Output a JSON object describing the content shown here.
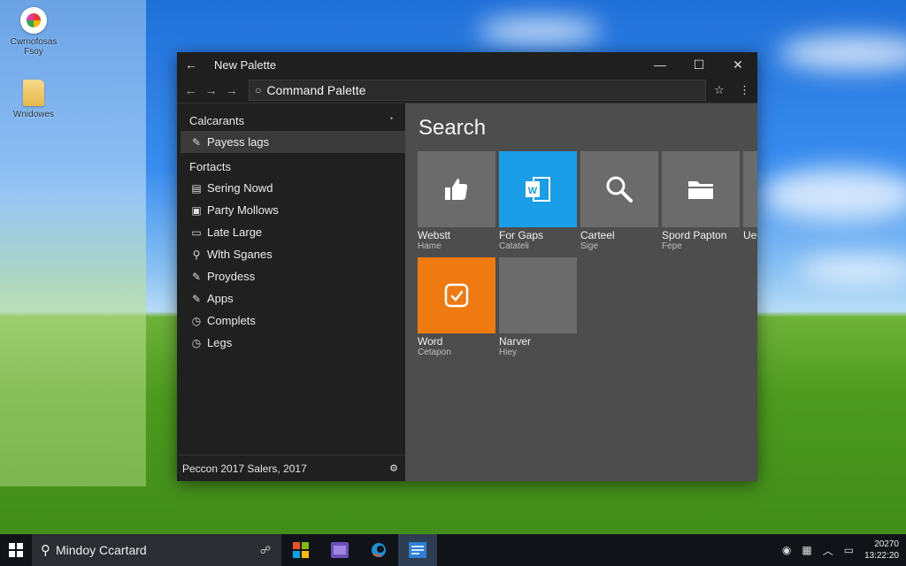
{
  "desktop": {
    "icons": [
      {
        "label_line1": "Cwrnofosas",
        "label_line2": "Fsoy",
        "icon": "photos-icon"
      },
      {
        "label_line1": "Wnidowes",
        "icon": "folder-icon"
      }
    ]
  },
  "window": {
    "title": "New Palette",
    "address": "Command Palette",
    "sidebar": {
      "section1": "Calcarants",
      "active_item": "Payess lags",
      "section2": "Fortacts",
      "items": [
        {
          "label": "Sering Nowd",
          "icon": "table-icon"
        },
        {
          "label": "Party Mollows",
          "icon": "image-icon"
        },
        {
          "label": "Late Large",
          "icon": "monitor-icon"
        },
        {
          "label": "Wlth Sganes",
          "icon": "wrench-icon"
        },
        {
          "label": "Proydess",
          "icon": "pencil-icon"
        },
        {
          "label": "Apps",
          "icon": "pencil-icon"
        },
        {
          "label": "Complets",
          "icon": "clock-icon"
        },
        {
          "label": "Legs",
          "icon": "clock-icon"
        }
      ],
      "footer": "Peccon 2017 Salers, 2017"
    },
    "main": {
      "heading": "Search",
      "tiles": [
        {
          "label": "Webstt",
          "sub": "Hame",
          "color": "#6b6b6b",
          "icon": "thumbs-up-icon"
        },
        {
          "label": "For Gaps",
          "sub": "Catateli",
          "color": "#1a9ee8",
          "icon": "word-icon"
        },
        {
          "label": "Carteel",
          "sub": "Sige",
          "color": "#6b6b6b",
          "icon": "magnifier-icon"
        },
        {
          "label": "Spord Papton",
          "sub": "Fepe",
          "color": "#6b6b6b",
          "icon": "folder-icon"
        },
        {
          "label": "Ue",
          "sub": "",
          "color": "#6b6b6b",
          "icon": ""
        },
        {
          "label": "Word",
          "sub": "Cetapon",
          "color": "#f07a12",
          "icon": "check-note-icon"
        },
        {
          "label": "Narver",
          "sub": "Hiey",
          "color": "#6b6b6b",
          "icon": ""
        }
      ]
    }
  },
  "taskbar": {
    "search_text": "Mindoy Ccartard",
    "clock_line1": "20270",
    "clock_line2": "13:22:20"
  }
}
